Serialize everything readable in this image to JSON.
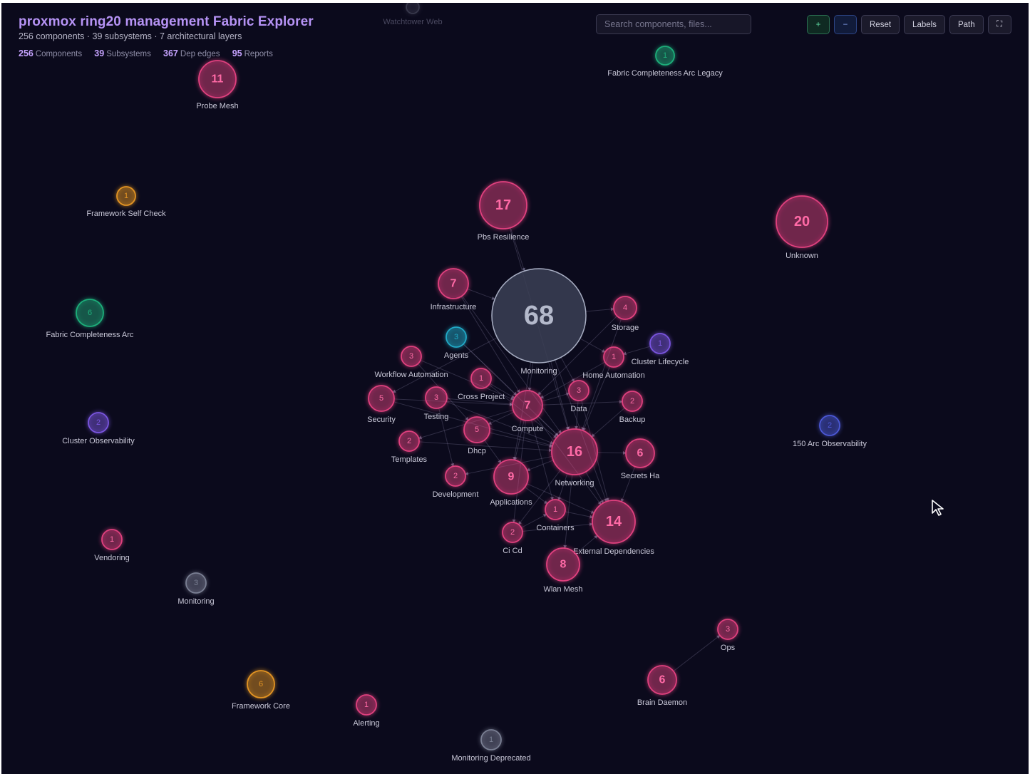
{
  "app": {
    "title": "proxmox ring20 management Fabric Explorer",
    "subtitle": "256 components · 39 subsystems · 7 architectural layers"
  },
  "stats": [
    {
      "value": "256",
      "label": "Components"
    },
    {
      "value": "39",
      "label": "Subsystems"
    },
    {
      "value": "367",
      "label": "Dep edges"
    },
    {
      "value": "95",
      "label": "Reports"
    }
  ],
  "search": {
    "placeholder": "Search components, files..."
  },
  "toolbar": {
    "zoom_in": "+",
    "zoom_out": "−",
    "reset": "Reset",
    "labels": "Labels",
    "path": "Path",
    "fullscreen": "⛶"
  },
  "colors": {
    "background": "#0b0a1c",
    "pink": "#e0407e",
    "green": "#1fae7a",
    "orange": "#e39424",
    "purple": "#7a55e0",
    "cyan": "#20a9c6",
    "blue": "#4c58d6",
    "gray": "#7a7f93",
    "hub": "#9aa1b6"
  },
  "nodes": [
    {
      "id": "watchtower-web",
      "label": "Watchtower Web",
      "count": "",
      "color": "gray"
    },
    {
      "id": "fabric-completeness-arc-legacy",
      "label": "Fabric Completeness Arc Legacy",
      "count": "1",
      "color": "green"
    },
    {
      "id": "probe-mesh",
      "label": "Probe Mesh",
      "count": "11",
      "color": "pink"
    },
    {
      "id": "framework-self-check",
      "label": "Framework Self Check",
      "count": "1",
      "color": "orange"
    },
    {
      "id": "pbs-resilience",
      "label": "Pbs Resilience",
      "count": "17",
      "color": "pink"
    },
    {
      "id": "unknown",
      "label": "Unknown",
      "count": "20",
      "color": "pink"
    },
    {
      "id": "fabric-completeness-arc",
      "label": "Fabric Completeness Arc",
      "count": "6",
      "color": "green"
    },
    {
      "id": "infrastructure",
      "label": "Infrastructure",
      "count": "7",
      "color": "pink"
    },
    {
      "id": "monitoring-hub",
      "label": "Monitoring",
      "count": "68",
      "color": "hub"
    },
    {
      "id": "storage",
      "label": "Storage",
      "count": "4",
      "color": "pink"
    },
    {
      "id": "agents",
      "label": "Agents",
      "count": "3",
      "color": "cyan"
    },
    {
      "id": "cluster-lifecycle",
      "label": "Cluster Lifecycle",
      "count": "1",
      "color": "purple"
    },
    {
      "id": "workflow-automation",
      "label": "Workflow Automation",
      "count": "3",
      "color": "pink"
    },
    {
      "id": "home-automation",
      "label": "Home Automation",
      "count": "1",
      "color": "pink"
    },
    {
      "id": "cross-project",
      "label": "Cross Project",
      "count": "1",
      "color": "pink"
    },
    {
      "id": "security",
      "label": "Security",
      "count": "5",
      "color": "pink"
    },
    {
      "id": "testing",
      "label": "Testing",
      "count": "3",
      "color": "pink"
    },
    {
      "id": "compute",
      "label": "Compute",
      "count": "7",
      "color": "pink"
    },
    {
      "id": "data",
      "label": "Data",
      "count": "3",
      "color": "pink"
    },
    {
      "id": "backup",
      "label": "Backup",
      "count": "2",
      "color": "pink"
    },
    {
      "id": "cluster-observability",
      "label": "Cluster Observability",
      "count": "2",
      "color": "purple"
    },
    {
      "id": "arc-observability-150",
      "label": "150 Arc Observability",
      "count": "2",
      "color": "blue"
    },
    {
      "id": "dhcp",
      "label": "Dhcp",
      "count": "5",
      "color": "pink"
    },
    {
      "id": "templates",
      "label": "Templates",
      "count": "2",
      "color": "pink"
    },
    {
      "id": "networking",
      "label": "Networking",
      "count": "16",
      "color": "pink"
    },
    {
      "id": "secrets-ha",
      "label": "Secrets Ha",
      "count": "6",
      "color": "pink"
    },
    {
      "id": "development",
      "label": "Development",
      "count": "2",
      "color": "pink"
    },
    {
      "id": "applications",
      "label": "Applications",
      "count": "9",
      "color": "pink"
    },
    {
      "id": "containers",
      "label": "Containers",
      "count": "1",
      "color": "pink"
    },
    {
      "id": "external-dependencies",
      "label": "External Dependencies",
      "count": "14",
      "color": "pink"
    },
    {
      "id": "vendoring",
      "label": "Vendoring",
      "count": "1",
      "color": "pink"
    },
    {
      "id": "ci-cd",
      "label": "Ci Cd",
      "count": "2",
      "color": "pink"
    },
    {
      "id": "wlan-mesh",
      "label": "Wlan Mesh",
      "count": "8",
      "color": "pink"
    },
    {
      "id": "monitoring-small",
      "label": "Monitoring",
      "count": "3",
      "color": "gray"
    },
    {
      "id": "ops",
      "label": "Ops",
      "count": "3",
      "color": "pink"
    },
    {
      "id": "framework-core",
      "label": "Framework Core",
      "count": "6",
      "color": "orange"
    },
    {
      "id": "brain-daemon",
      "label": "Brain Daemon",
      "count": "6",
      "color": "pink"
    },
    {
      "id": "alerting",
      "label": "Alerting",
      "count": "1",
      "color": "pink"
    },
    {
      "id": "monitoring-deprecated",
      "label": "Monitoring Deprecated",
      "count": "1",
      "color": "gray"
    }
  ],
  "edges": [
    [
      "pbs-resilience",
      "monitoring-hub"
    ],
    [
      "pbs-resilience",
      "networking"
    ],
    [
      "infrastructure",
      "monitoring-hub"
    ],
    [
      "infrastructure",
      "compute"
    ],
    [
      "infrastructure",
      "networking"
    ],
    [
      "monitoring-hub",
      "compute"
    ],
    [
      "monitoring-hub",
      "networking"
    ],
    [
      "monitoring-hub",
      "data"
    ],
    [
      "monitoring-hub",
      "home-automation"
    ],
    [
      "monitoring-hub",
      "storage"
    ],
    [
      "monitoring-hub",
      "applications"
    ],
    [
      "monitoring-hub",
      "external-dependencies"
    ],
    [
      "monitoring-hub",
      "security"
    ],
    [
      "storage",
      "compute"
    ],
    [
      "storage",
      "networking"
    ],
    [
      "agents",
      "compute"
    ],
    [
      "agents",
      "networking"
    ],
    [
      "cluster-lifecycle",
      "home-automation"
    ],
    [
      "workflow-automation",
      "compute"
    ],
    [
      "workflow-automation",
      "dhcp"
    ],
    [
      "home-automation",
      "networking"
    ],
    [
      "home-automation",
      "compute"
    ],
    [
      "cross-project",
      "compute"
    ],
    [
      "cross-project",
      "networking"
    ],
    [
      "security",
      "compute"
    ],
    [
      "security",
      "networking"
    ],
    [
      "testing",
      "compute"
    ],
    [
      "testing",
      "networking"
    ],
    [
      "testing",
      "development"
    ],
    [
      "compute",
      "networking"
    ],
    [
      "compute",
      "data"
    ],
    [
      "compute",
      "backup"
    ],
    [
      "compute",
      "applications"
    ],
    [
      "compute",
      "dhcp"
    ],
    [
      "compute",
      "templates"
    ],
    [
      "compute",
      "containers"
    ],
    [
      "compute",
      "ci-cd"
    ],
    [
      "compute",
      "external-dependencies"
    ],
    [
      "data",
      "networking"
    ],
    [
      "data",
      "external-dependencies"
    ],
    [
      "backup",
      "networking"
    ],
    [
      "dhcp",
      "networking"
    ],
    [
      "dhcp",
      "applications"
    ],
    [
      "templates",
      "networking"
    ],
    [
      "networking",
      "secrets-ha"
    ],
    [
      "networking",
      "applications"
    ],
    [
      "networking",
      "development"
    ],
    [
      "networking",
      "containers"
    ],
    [
      "networking",
      "external-dependencies"
    ],
    [
      "networking",
      "ci-cd"
    ],
    [
      "networking",
      "wlan-mesh"
    ],
    [
      "secrets-ha",
      "external-dependencies"
    ],
    [
      "applications",
      "external-dependencies"
    ],
    [
      "applications",
      "containers"
    ],
    [
      "containers",
      "external-dependencies"
    ],
    [
      "ci-cd",
      "external-dependencies"
    ],
    [
      "ci-cd",
      "containers"
    ],
    [
      "wlan-mesh",
      "external-dependencies"
    ],
    [
      "brain-daemon",
      "ops"
    ]
  ]
}
